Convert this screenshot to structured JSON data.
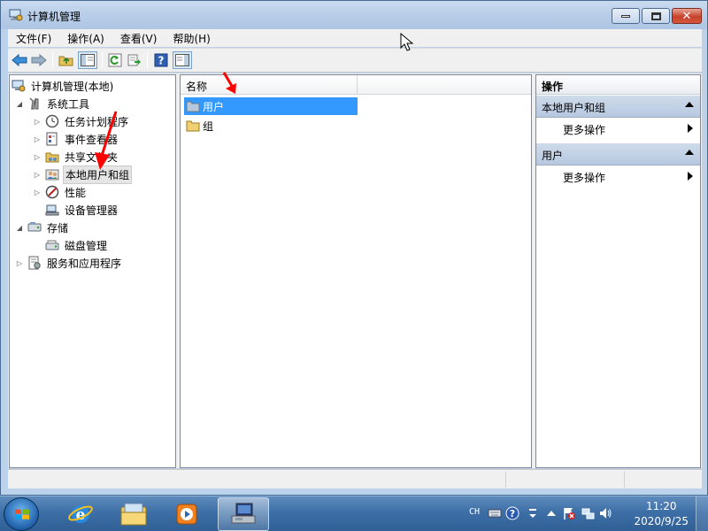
{
  "window": {
    "title": "计算机管理"
  },
  "menubar": {
    "items": [
      "文件(F)",
      "操作(A)",
      "查看(V)",
      "帮助(H)"
    ]
  },
  "tree": {
    "root": "计算机管理(本地)",
    "system_tools": "系统工具",
    "task_scheduler": "任务计划程序",
    "event_viewer": "事件查看器",
    "shared_folders": "共享文件夹",
    "local_users_groups": "本地用户和组",
    "performance": "性能",
    "device_manager": "设备管理器",
    "storage": "存储",
    "disk_management": "磁盘管理",
    "services_apps": "服务和应用程序"
  },
  "list": {
    "column_name": "名称",
    "rows": [
      "用户",
      "组"
    ]
  },
  "actions": {
    "title": "操作",
    "section1": "本地用户和组",
    "section1_more": "更多操作",
    "section2": "用户",
    "section2_more": "更多操作"
  },
  "taskbar": {
    "lang": "CH",
    "time": "11:20",
    "date": "2020/9/25"
  },
  "colors": {
    "selection": "#3399ff",
    "annotation_arrow": "#ff0000",
    "taskbar": "#3d6fa6"
  }
}
